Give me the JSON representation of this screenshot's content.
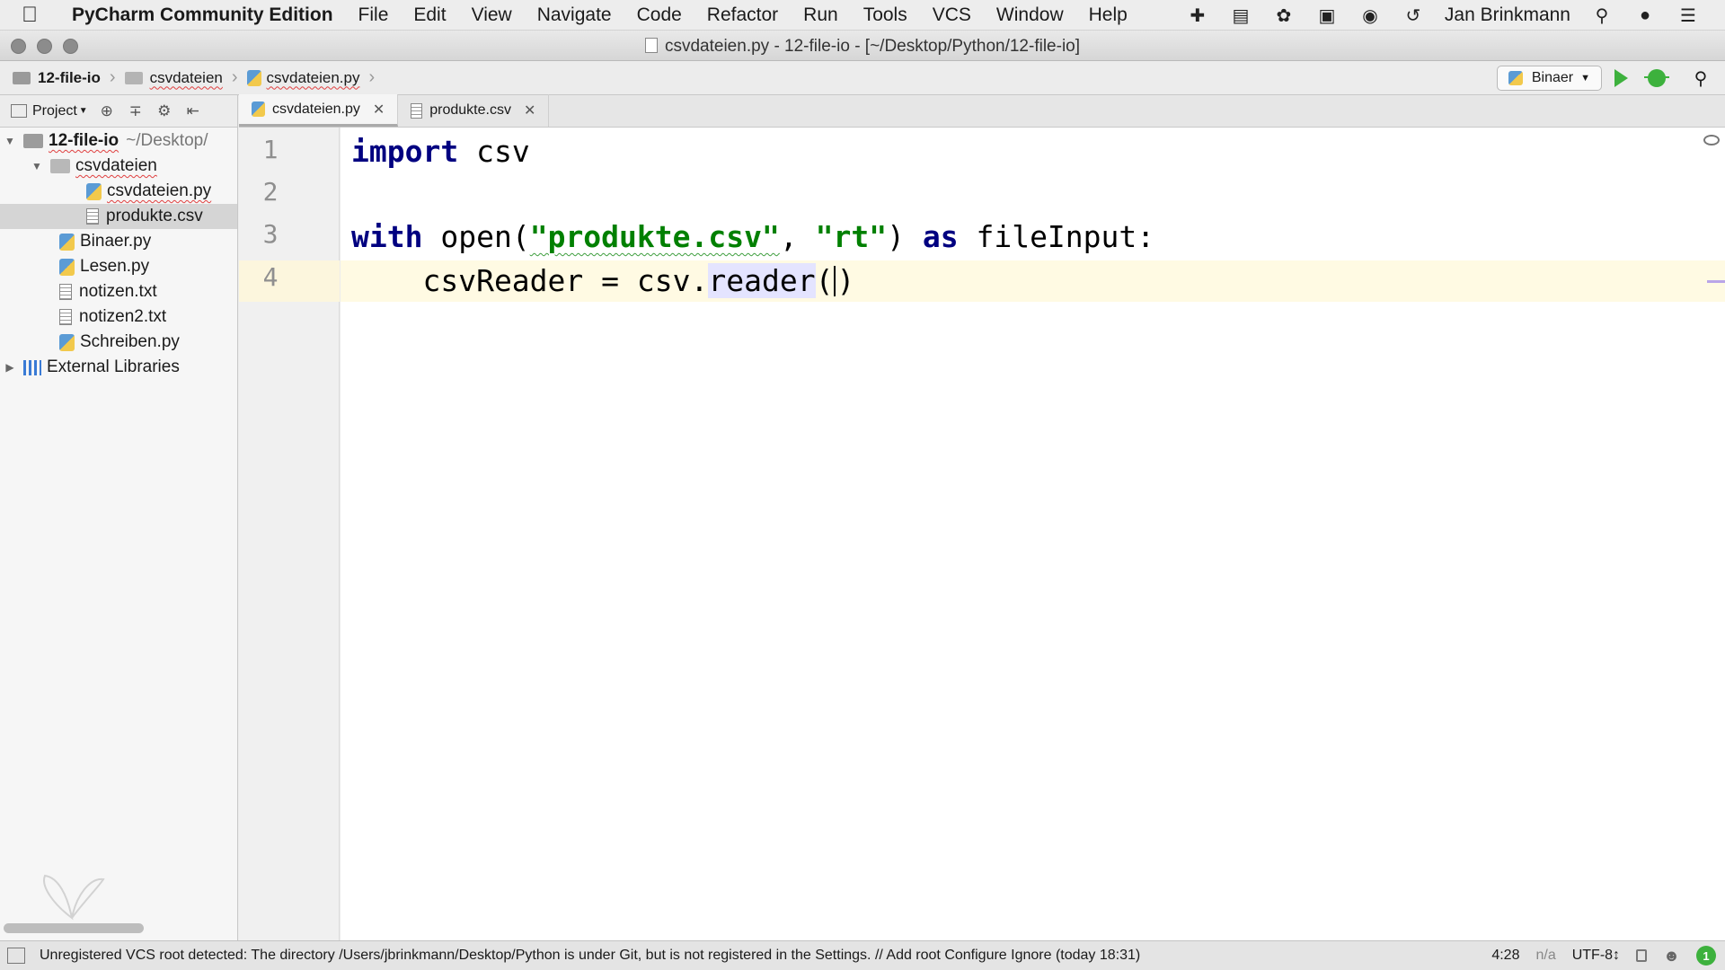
{
  "menubar": {
    "app_name": "PyCharm Community Edition",
    "items": [
      "File",
      "Edit",
      "View",
      "Navigate",
      "Code",
      "Refactor",
      "Run",
      "Tools",
      "VCS",
      "Window",
      "Help"
    ],
    "user": "Jan Brinkmann"
  },
  "window": {
    "title": "csvdateien.py - 12-file-io - [~/Desktop/Python/12-file-io]"
  },
  "navbar": {
    "crumbs": [
      "12-file-io",
      "csvdateien",
      "csvdateien.py"
    ],
    "run_config": "Binaer"
  },
  "project_panel": {
    "label": "Project"
  },
  "tabs": [
    {
      "label": "csvdateien.py",
      "active": true
    },
    {
      "label": "produkte.csv",
      "active": false
    }
  ],
  "tree": {
    "root": {
      "label": "12-file-io",
      "hint": "~/Desktop/"
    },
    "folder": "csvdateien",
    "folder_files": [
      "csvdateien.py",
      "produkte.csv"
    ],
    "files": [
      "Binaer.py",
      "Lesen.py",
      "notizen.txt",
      "notizen2.txt",
      "Schreiben.py"
    ],
    "external": "External Libraries"
  },
  "editor": {
    "line_numbers": [
      "1",
      "2",
      "3",
      "4"
    ],
    "code": {
      "l1_kw": "import",
      "l1_rest": " csv",
      "l3_kw1": "with",
      "l3_fn": " open(",
      "l3_str1": "\"produkte.csv\"",
      "l3_comma": ", ",
      "l3_str2": "\"rt\"",
      "l3_close": ") ",
      "l3_kw2": "as",
      "l3_rest": " fileInput:",
      "l4_indent": "    csvReader = csv.",
      "l4_hl": "reader",
      "l4_open": "(",
      "l4_close": ")"
    }
  },
  "statusbar": {
    "message": "Unregistered VCS root detected: The directory /Users/jbrinkmann/Desktop/Python is under Git, but is not registered in the Settings. // Add root  Configure  Ignore (today 18:31)",
    "position": "4:28",
    "na": "n/a",
    "encoding": "UTF-8↕",
    "notifications": "1"
  }
}
